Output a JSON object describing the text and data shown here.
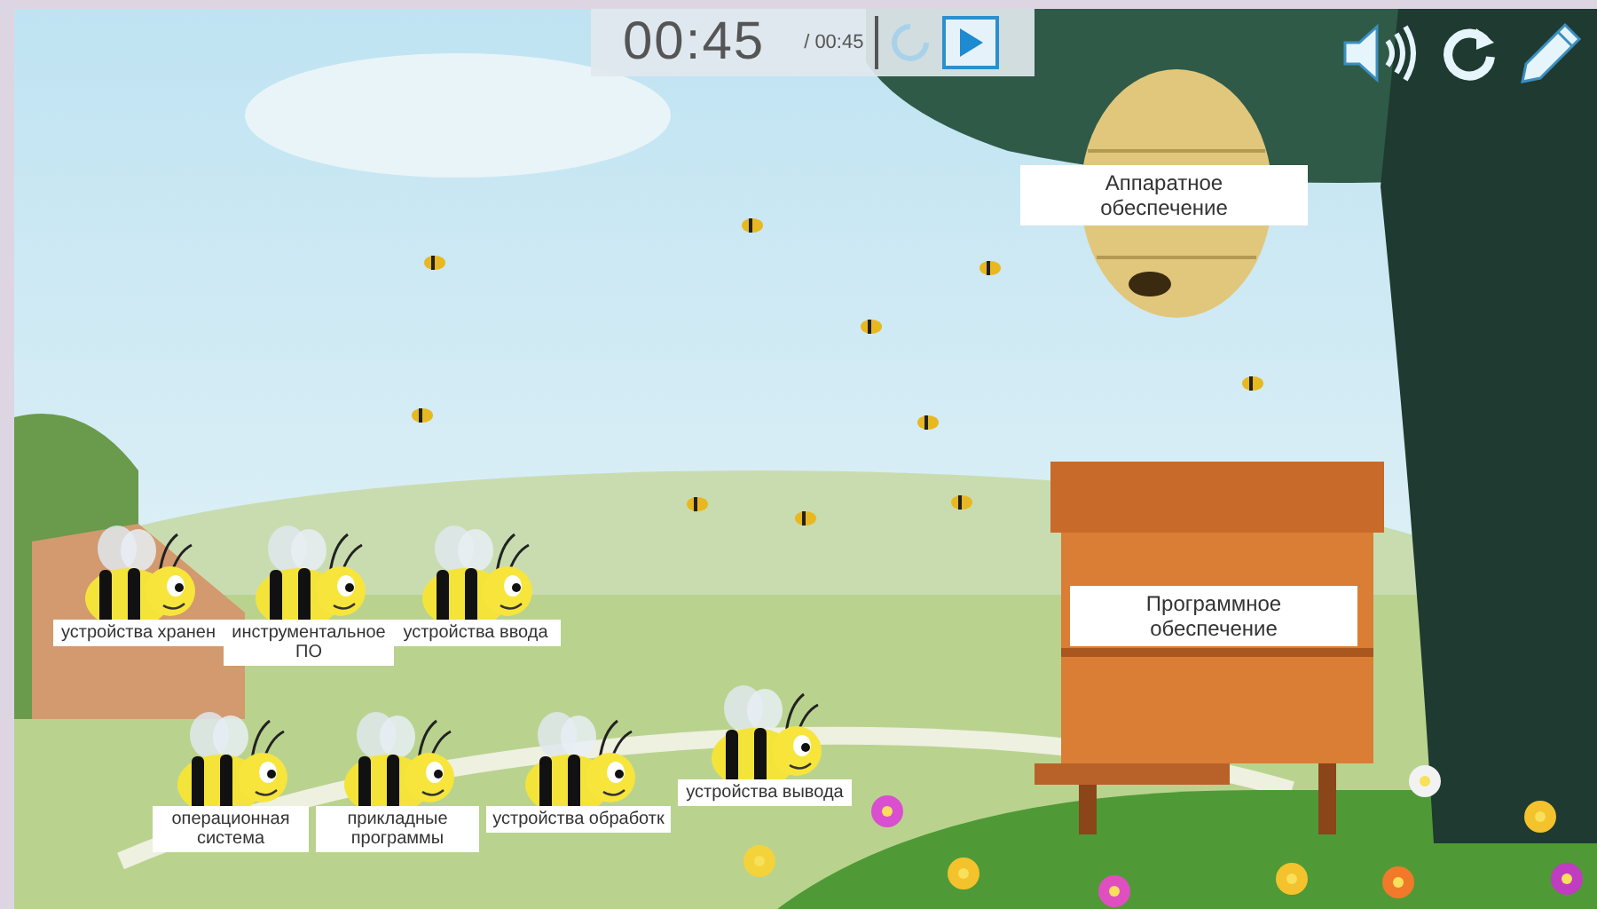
{
  "timer": {
    "elapsed": "00:45",
    "total": "/ 00:45"
  },
  "targets": [
    {
      "label": "Аппаратное обеспечение"
    },
    {
      "label": "Программное обеспечение"
    }
  ],
  "bees": [
    {
      "label": "устройства хранен"
    },
    {
      "label": "инструментальное ПО"
    },
    {
      "label": "устройства ввода"
    },
    {
      "label": "операционная система"
    },
    {
      "label": "прикладные программы"
    },
    {
      "label": "устройства обработк"
    },
    {
      "label": "устройства вывода"
    }
  ]
}
